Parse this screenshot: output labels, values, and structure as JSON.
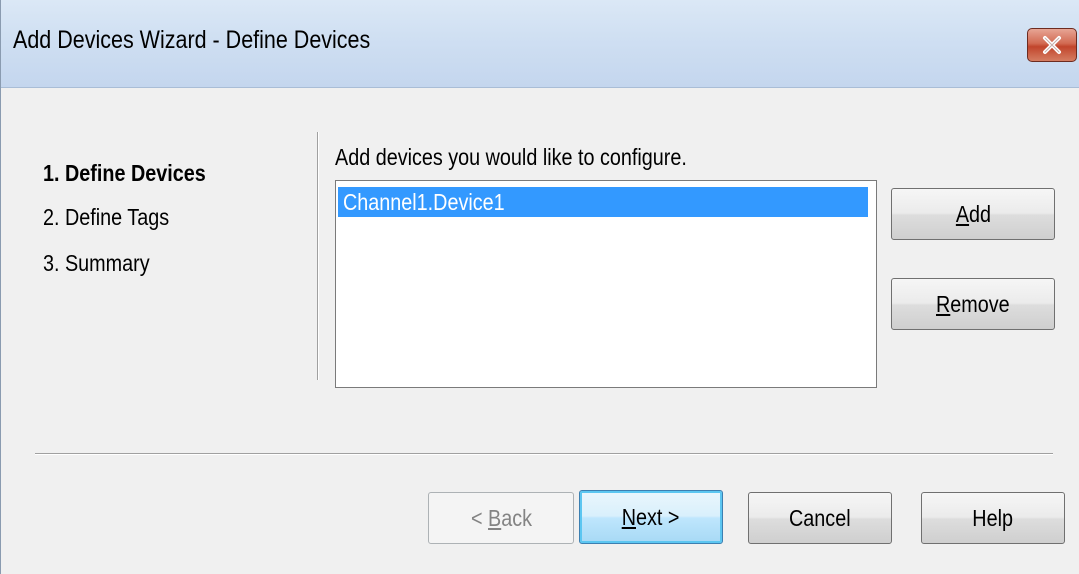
{
  "window": {
    "title": "Add Devices Wizard - Define Devices",
    "close_glyph": "X"
  },
  "steps": [
    {
      "label": "1. Define Devices",
      "active": true
    },
    {
      "label": "2. Define Tags",
      "active": false
    },
    {
      "label": "3. Summary",
      "active": false
    }
  ],
  "content": {
    "instruction": "Add devices you would like to configure.",
    "devices": [
      "Channel1.Device1"
    ],
    "selected_device": "Channel1.Device1"
  },
  "side_buttons": {
    "add": {
      "label": "Add",
      "mnemonic": "A",
      "rest": "dd"
    },
    "remove": {
      "label": "Remove",
      "mnemonic": "R",
      "rest": "emove"
    }
  },
  "footer_buttons": {
    "back": {
      "label": "< Back",
      "prefix": "< ",
      "mnemonic": "B",
      "rest": "ack",
      "enabled": false
    },
    "next": {
      "label": "Next >",
      "mnemonic": "N",
      "rest": "ext >",
      "default": true
    },
    "cancel": {
      "label": "Cancel"
    },
    "help": {
      "label": "Help"
    }
  },
  "colors": {
    "selection": "#3399ff",
    "close_button": "#c1452c",
    "title_bar": "#cfdff2"
  },
  "icons": {
    "close": "close-icon"
  }
}
